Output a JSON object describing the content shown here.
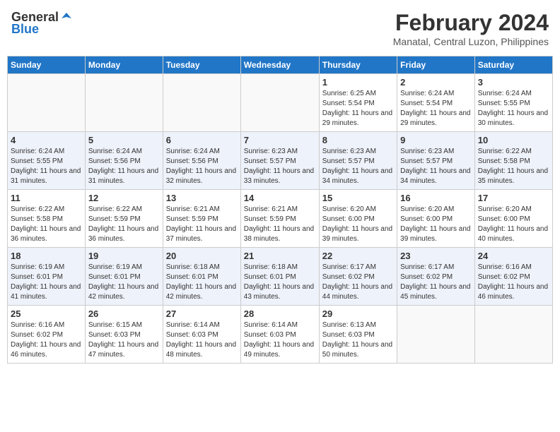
{
  "header": {
    "logo_general": "General",
    "logo_blue": "Blue",
    "month": "February 2024",
    "location": "Manatal, Central Luzon, Philippines"
  },
  "weekdays": [
    "Sunday",
    "Monday",
    "Tuesday",
    "Wednesday",
    "Thursday",
    "Friday",
    "Saturday"
  ],
  "weeks": [
    [
      {
        "day": "",
        "info": ""
      },
      {
        "day": "",
        "info": ""
      },
      {
        "day": "",
        "info": ""
      },
      {
        "day": "",
        "info": ""
      },
      {
        "day": "1",
        "info": "Sunrise: 6:25 AM\nSunset: 5:54 PM\nDaylight: 11 hours and 29 minutes."
      },
      {
        "day": "2",
        "info": "Sunrise: 6:24 AM\nSunset: 5:54 PM\nDaylight: 11 hours and 29 minutes."
      },
      {
        "day": "3",
        "info": "Sunrise: 6:24 AM\nSunset: 5:55 PM\nDaylight: 11 hours and 30 minutes."
      }
    ],
    [
      {
        "day": "4",
        "info": "Sunrise: 6:24 AM\nSunset: 5:55 PM\nDaylight: 11 hours and 31 minutes."
      },
      {
        "day": "5",
        "info": "Sunrise: 6:24 AM\nSunset: 5:56 PM\nDaylight: 11 hours and 31 minutes."
      },
      {
        "day": "6",
        "info": "Sunrise: 6:24 AM\nSunset: 5:56 PM\nDaylight: 11 hours and 32 minutes."
      },
      {
        "day": "7",
        "info": "Sunrise: 6:23 AM\nSunset: 5:57 PM\nDaylight: 11 hours and 33 minutes."
      },
      {
        "day": "8",
        "info": "Sunrise: 6:23 AM\nSunset: 5:57 PM\nDaylight: 11 hours and 34 minutes."
      },
      {
        "day": "9",
        "info": "Sunrise: 6:23 AM\nSunset: 5:57 PM\nDaylight: 11 hours and 34 minutes."
      },
      {
        "day": "10",
        "info": "Sunrise: 6:22 AM\nSunset: 5:58 PM\nDaylight: 11 hours and 35 minutes."
      }
    ],
    [
      {
        "day": "11",
        "info": "Sunrise: 6:22 AM\nSunset: 5:58 PM\nDaylight: 11 hours and 36 minutes."
      },
      {
        "day": "12",
        "info": "Sunrise: 6:22 AM\nSunset: 5:59 PM\nDaylight: 11 hours and 36 minutes."
      },
      {
        "day": "13",
        "info": "Sunrise: 6:21 AM\nSunset: 5:59 PM\nDaylight: 11 hours and 37 minutes."
      },
      {
        "day": "14",
        "info": "Sunrise: 6:21 AM\nSunset: 5:59 PM\nDaylight: 11 hours and 38 minutes."
      },
      {
        "day": "15",
        "info": "Sunrise: 6:20 AM\nSunset: 6:00 PM\nDaylight: 11 hours and 39 minutes."
      },
      {
        "day": "16",
        "info": "Sunrise: 6:20 AM\nSunset: 6:00 PM\nDaylight: 11 hours and 39 minutes."
      },
      {
        "day": "17",
        "info": "Sunrise: 6:20 AM\nSunset: 6:00 PM\nDaylight: 11 hours and 40 minutes."
      }
    ],
    [
      {
        "day": "18",
        "info": "Sunrise: 6:19 AM\nSunset: 6:01 PM\nDaylight: 11 hours and 41 minutes."
      },
      {
        "day": "19",
        "info": "Sunrise: 6:19 AM\nSunset: 6:01 PM\nDaylight: 11 hours and 42 minutes."
      },
      {
        "day": "20",
        "info": "Sunrise: 6:18 AM\nSunset: 6:01 PM\nDaylight: 11 hours and 42 minutes."
      },
      {
        "day": "21",
        "info": "Sunrise: 6:18 AM\nSunset: 6:01 PM\nDaylight: 11 hours and 43 minutes."
      },
      {
        "day": "22",
        "info": "Sunrise: 6:17 AM\nSunset: 6:02 PM\nDaylight: 11 hours and 44 minutes."
      },
      {
        "day": "23",
        "info": "Sunrise: 6:17 AM\nSunset: 6:02 PM\nDaylight: 11 hours and 45 minutes."
      },
      {
        "day": "24",
        "info": "Sunrise: 6:16 AM\nSunset: 6:02 PM\nDaylight: 11 hours and 46 minutes."
      }
    ],
    [
      {
        "day": "25",
        "info": "Sunrise: 6:16 AM\nSunset: 6:02 PM\nDaylight: 11 hours and 46 minutes."
      },
      {
        "day": "26",
        "info": "Sunrise: 6:15 AM\nSunset: 6:03 PM\nDaylight: 11 hours and 47 minutes."
      },
      {
        "day": "27",
        "info": "Sunrise: 6:14 AM\nSunset: 6:03 PM\nDaylight: 11 hours and 48 minutes."
      },
      {
        "day": "28",
        "info": "Sunrise: 6:14 AM\nSunset: 6:03 PM\nDaylight: 11 hours and 49 minutes."
      },
      {
        "day": "29",
        "info": "Sunrise: 6:13 AM\nSunset: 6:03 PM\nDaylight: 11 hours and 50 minutes."
      },
      {
        "day": "",
        "info": ""
      },
      {
        "day": "",
        "info": ""
      }
    ]
  ]
}
